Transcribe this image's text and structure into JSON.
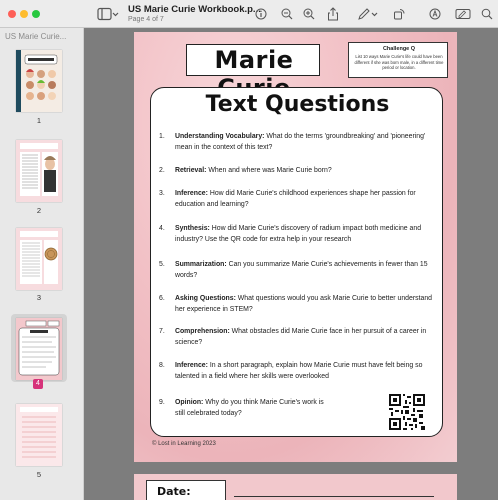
{
  "toolbar": {
    "doc_title": "US Marie Curie Workbook.p...",
    "doc_subtitle": "Page 4 of 7"
  },
  "sidebar": {
    "title": "US Marie Curie...",
    "pages": [
      "1",
      "2",
      "3",
      "4",
      "5"
    ],
    "selected_page": "4"
  },
  "page": {
    "main_title": "Marie Curie",
    "challenge_title": "Challenge Q",
    "challenge_text": "List 10 ways Marie Curie's life could have been different if she was born male, in a different time period or location.",
    "card_title": "Text Questions",
    "questions": [
      {
        "num": "1.",
        "label": "Understanding Vocabulary:",
        "text": " What do the terms 'groundbreaking' and 'pioneering' mean in the context of this text?"
      },
      {
        "num": "2.",
        "label": "Retrieval:",
        "text": " When and where was Marie Curie born?"
      },
      {
        "num": "3.",
        "label": "Inference:",
        "text": " How did Marie Curie's childhood experiences shape her passion for education and learning?"
      },
      {
        "num": "4.",
        "label": "Synthesis:",
        "text": " How did Marie Curie's discovery of radium impact both medicine and industry? Use the QR code for extra help in your research"
      },
      {
        "num": "5.",
        "label": "Summarization:",
        "text": " Can you summarize Marie Curie's achievements in fewer than 15 words?"
      },
      {
        "num": "6.",
        "label": "Asking Questions:",
        "text": " What questions would you ask Marie Curie to better understand her experience in STEM?"
      },
      {
        "num": "7.",
        "label": "Comprehension:",
        "text": " What obstacles did Marie Curie face in her pursuit of a career in science?"
      },
      {
        "num": "8.",
        "label": "Inference:",
        "text": " In a short paragraph, explain how Marie Curie must have felt being so talented in a field where her skills were overlooked"
      },
      {
        "num": "9.",
        "label": "Opinion:",
        "text": " Why do you think Marie Curie's work is still celebrated today?"
      }
    ],
    "footer": "© Lost in Learning 2023"
  },
  "next_page": {
    "date_label": "Date:"
  },
  "colors": {
    "accent": "#d6337a",
    "page_pink": "#f2c1c6"
  }
}
